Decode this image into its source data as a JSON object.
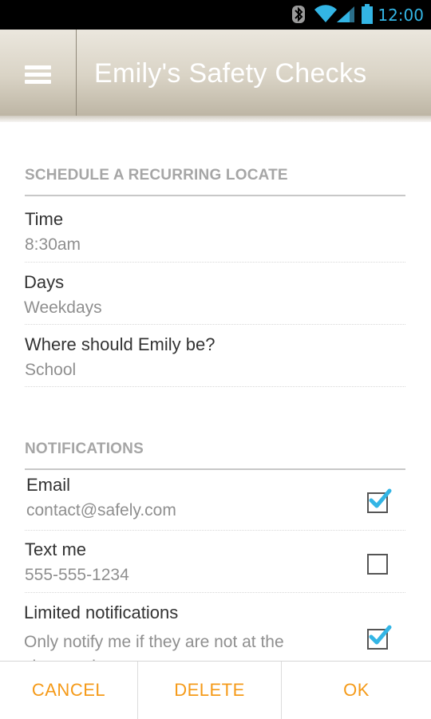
{
  "status_bar": {
    "time": "12:00",
    "icons": [
      "bluetooth-icon",
      "wifi-icon",
      "signal-icon",
      "battery-icon"
    ],
    "accent": "#33b5e5"
  },
  "action_bar": {
    "menu_icon": "hamburger-menu-icon",
    "title": "Emily's Safety Checks"
  },
  "schedule": {
    "header": "SCHEDULE A RECURRING LOCATE",
    "rows": [
      {
        "title": "Time",
        "value": "8:30am"
      },
      {
        "title": "Days",
        "value": "Weekdays"
      },
      {
        "title": "Where should Emily be?",
        "value": "School"
      }
    ]
  },
  "notifications": {
    "header": "NOTIFICATIONS",
    "rows": [
      {
        "title": "Email",
        "value": "contact@safely.com",
        "checked": true
      },
      {
        "title": "Text me",
        "value": "555-555-1234",
        "checked": false
      },
      {
        "title": "Limited notifications",
        "value": "Only notify me if they are not at the chosen place",
        "checked": true
      }
    ]
  },
  "buttons": {
    "cancel": "CANCEL",
    "delete": "DELETE",
    "ok": "OK",
    "color": "#f59a18"
  }
}
